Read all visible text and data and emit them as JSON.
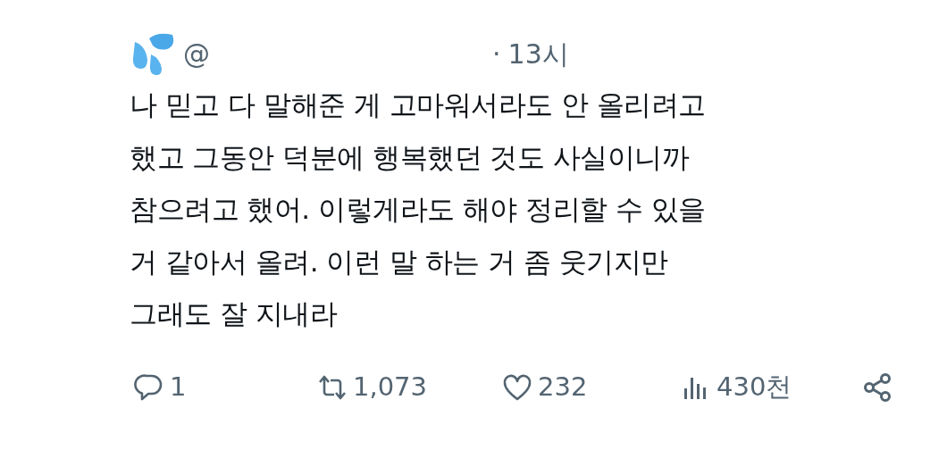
{
  "tweet": {
    "handle": "@",
    "separator": "·",
    "time": "13시",
    "text": "나 믿고 다 말해준 게 고마워서라도 안 올리려고\n했고 그동안 덕분에 행복했던 것도 사실이니까\n참으려고 했어. 이렇게라도 해야 정리할 수 있을\n거 같아서 올려. 이런 말 하는 거 좀 웃기지만\n그래도 잘 지내라",
    "actions": [
      {
        "kind": "reply",
        "count": "1"
      },
      {
        "kind": "retweet",
        "count": "1,073"
      },
      {
        "kind": "like",
        "count": "232"
      },
      {
        "kind": "views",
        "count": "430천"
      },
      {
        "kind": "share"
      }
    ]
  }
}
